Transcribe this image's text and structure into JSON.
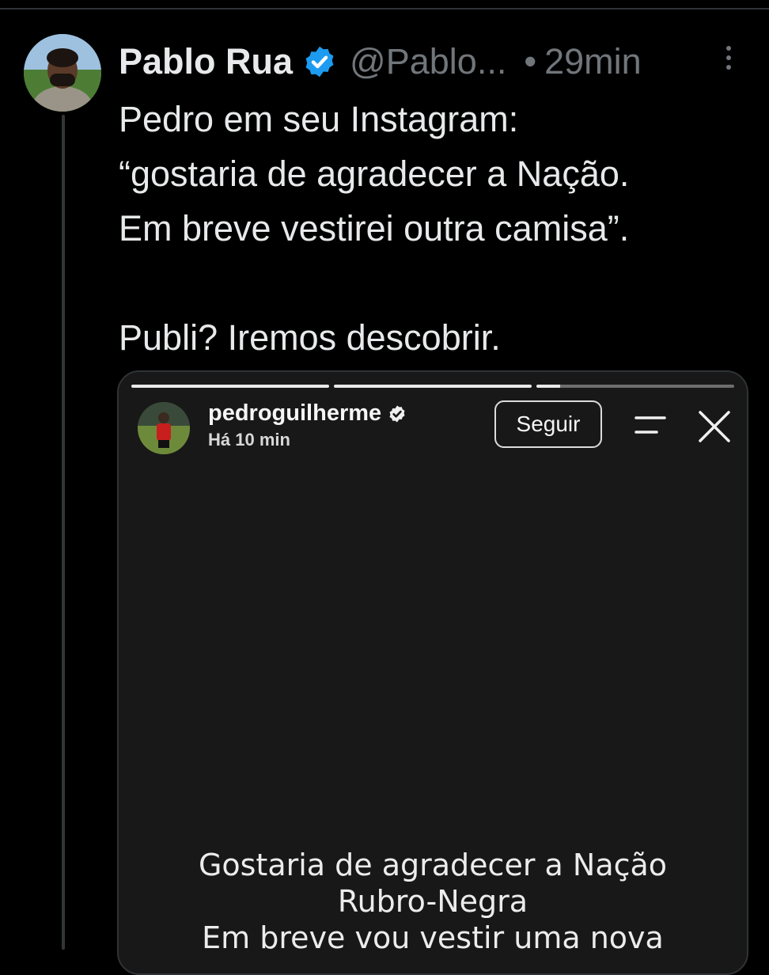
{
  "tweet": {
    "author_name": "Pablo Rua",
    "handle": "@Pablo...",
    "separator": "•",
    "time": "29min",
    "lines": [
      "Pedro em seu Instagram:",
      "“gostaria de agradecer a Nação.",
      "Em breve vestirei outra camisa”.",
      "",
      "Publi? Iremos descobrir."
    ]
  },
  "story": {
    "username": "pedroguilherme",
    "time": "Há 10 min",
    "follow_label": "Seguir",
    "progress": [
      1,
      1,
      0.12
    ],
    "text_lines": [
      "Gostaria de agradecer a Nação",
      "Rubro-Negra",
      "Em breve vou vestir uma nova"
    ]
  },
  "colors": {
    "background": "#000000",
    "verified": "#1d9bf0",
    "muted_text": "#71767b",
    "story_bg": "#181818"
  },
  "icons": {
    "verified": "verified-badge-icon",
    "more": "more-vertical-icon",
    "menu": "menu-icon",
    "close": "close-icon"
  }
}
